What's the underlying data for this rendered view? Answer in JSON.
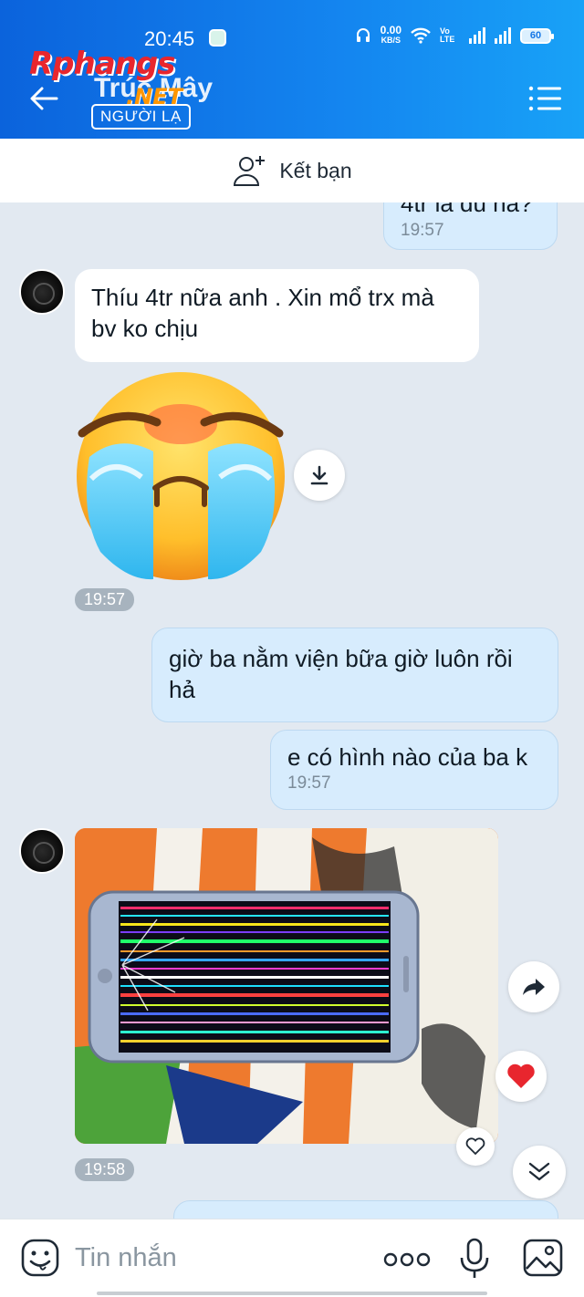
{
  "status": {
    "time": "20:45",
    "net_speed": "0.00",
    "net_unit": "KB/S",
    "volte": "Vo LTE",
    "battery": "60"
  },
  "header": {
    "contact_name": "Trúc Mây",
    "tag": "NGƯỜI LẠ",
    "watermark_main": "Rphangs",
    "watermark_sub": ".NET"
  },
  "add_friend": {
    "label": "Kết bạn"
  },
  "messages": {
    "out_top_partial": {
      "text": "4tr là đủ hả?",
      "time": "19:57"
    },
    "in_1": {
      "text": "Thíu 4tr nữa anh . Xin mổ trx mà bv ko chịu"
    },
    "sticker": {
      "time": "19:57"
    },
    "out_2": {
      "text": "giờ ba nằm viện bữa giờ luôn rồi hả"
    },
    "out_3": {
      "text": "e có hình nào của ba k",
      "time": "19:57"
    },
    "photo": {
      "time": "19:58"
    }
  },
  "composer": {
    "placeholder": "Tin nhắn"
  },
  "colors": {
    "header_start": "#0b63dc",
    "header_end": "#18a2f7",
    "bubble_out": "#d7ecfd",
    "chat_bg": "#e2e9f1",
    "heart": "#e8262e"
  },
  "icons": [
    "back-arrow-icon",
    "menu-icon",
    "add-friend-icon",
    "download-icon",
    "share-forward-icon",
    "heart-reaction-icon",
    "heart-outline-icon",
    "scroll-down-icon",
    "emoji-icon",
    "more-icon",
    "mic-icon",
    "image-icon"
  ]
}
